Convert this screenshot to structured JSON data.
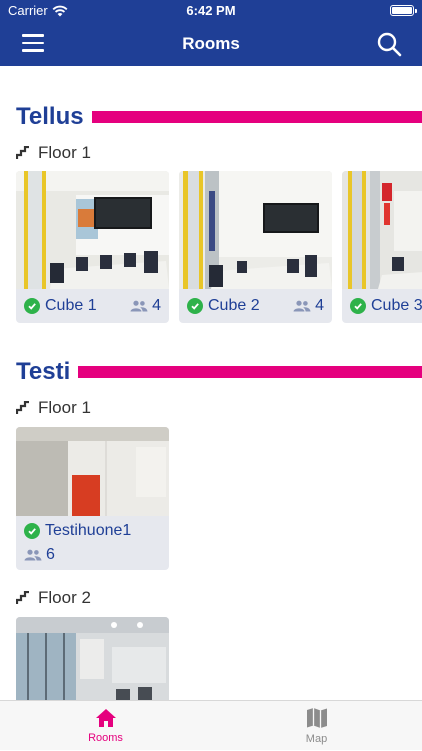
{
  "status_bar": {
    "carrier": "Carrier",
    "time": "6:42 PM"
  },
  "nav": {
    "title": "Rooms",
    "menu_icon": "hamburger-menu-icon",
    "search_icon": "search-icon"
  },
  "colors": {
    "brand": "#1f3f96",
    "accent": "#e5007e",
    "available": "#2eb24a"
  },
  "sections": [
    {
      "name": "Tellus",
      "floors": [
        {
          "label": "Floor 1",
          "rooms": [
            {
              "name": "Cube 1",
              "capacity": "4"
            },
            {
              "name": "Cube 2",
              "capacity": "4"
            },
            {
              "name": "Cube 3"
            }
          ]
        }
      ]
    },
    {
      "name": "Testi",
      "floors": [
        {
          "label": "Floor 1",
          "rooms": [
            {
              "name": "Testihuone1",
              "capacity": "6"
            }
          ]
        },
        {
          "label": "Floor 2"
        }
      ]
    }
  ],
  "tabbar": {
    "tabs": [
      {
        "label": "Rooms",
        "icon": "home-icon",
        "active": true
      },
      {
        "label": "Map",
        "icon": "map-icon",
        "active": false
      }
    ]
  }
}
